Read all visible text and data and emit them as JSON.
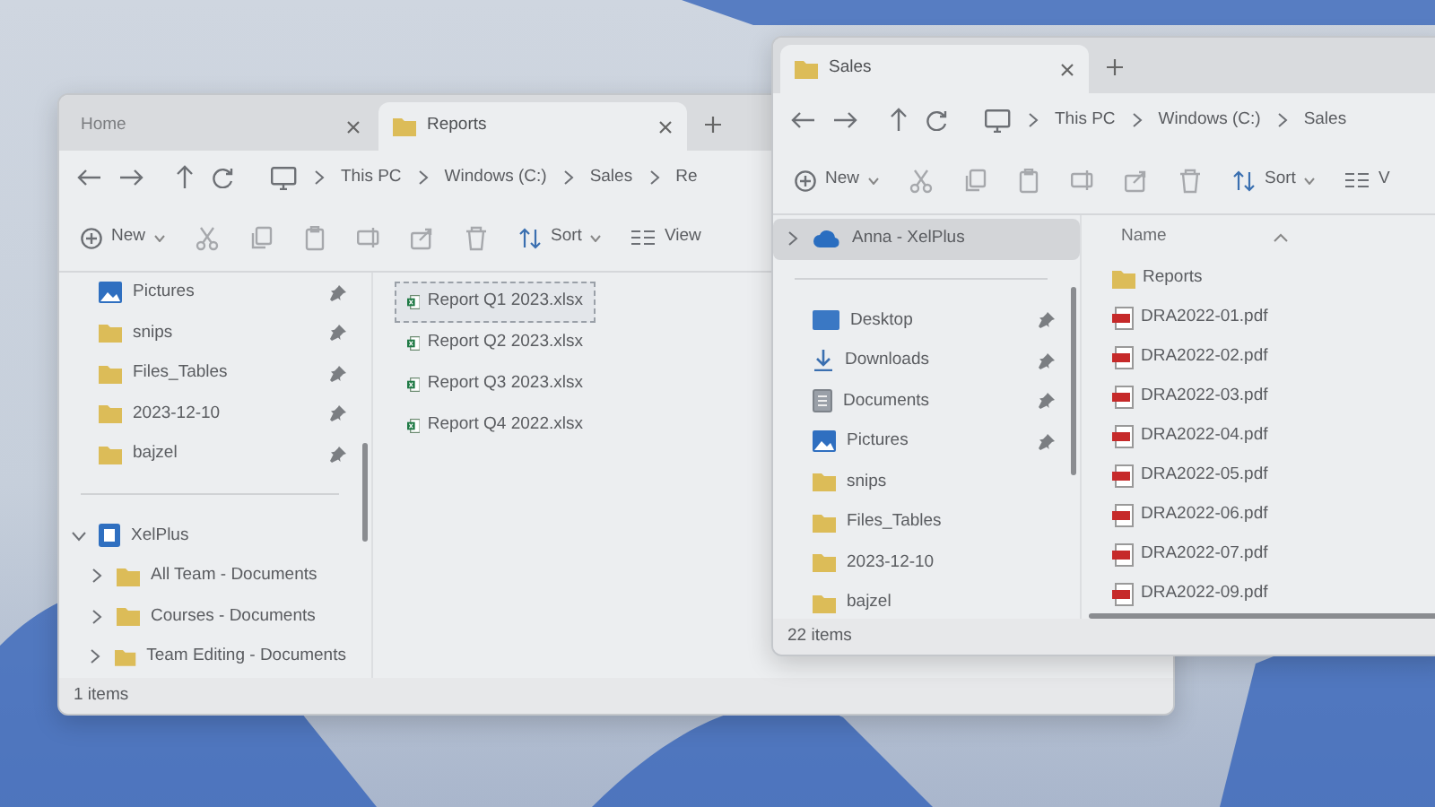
{
  "windows": [
    {
      "tabs": [
        {
          "label": "Home",
          "selected": false,
          "kind": "plain"
        },
        {
          "label": "Reports",
          "selected": true,
          "kind": "folder"
        }
      ],
      "breadcrumb": [
        "This PC",
        "Windows (C:)",
        "Sales",
        "Re"
      ],
      "toolbar": {
        "new_label": "New",
        "sort_label": "Sort",
        "view_label": "View"
      },
      "sidebar": [
        {
          "items": [
            {
              "label": "Pictures",
              "kind": "pictures",
              "pinned": true,
              "selected": false
            },
            {
              "label": "snips",
              "kind": "folder",
              "pinned": true,
              "selected": false
            },
            {
              "label": "Files_Tables",
              "kind": "folder",
              "pinned": true,
              "selected": false
            },
            {
              "label": "2023-12-10",
              "kind": "folder",
              "pinned": true,
              "selected": false
            },
            {
              "label": "bajzel",
              "kind": "folder",
              "pinned": true,
              "selected": false
            }
          ]
        },
        {
          "items": [
            {
              "label": "XelPlus",
              "kind": "site",
              "pinned": false,
              "selected": false,
              "expanded": true,
              "children": [
                {
                  "label": "All Team - Documents",
                  "kind": "folder",
                  "pinned": false,
                  "selected": false,
                  "expanded": false
                },
                {
                  "label": "Courses - Documents",
                  "kind": "folder",
                  "pinned": false,
                  "selected": false,
                  "expanded": false
                },
                {
                  "label": "Team Editing - Documents",
                  "kind": "folder",
                  "pinned": false,
                  "selected": false,
                  "expanded": false
                }
              ]
            }
          ]
        }
      ],
      "files": [
        {
          "name": "Report Q1 2023.xlsx",
          "kind": "xlsx",
          "selected": true
        },
        {
          "name": "Report Q2 2023.xlsx",
          "kind": "xlsx",
          "selected": false
        },
        {
          "name": "Report Q3 2023.xlsx",
          "kind": "xlsx",
          "selected": false
        },
        {
          "name": "Report Q4 2022.xlsx",
          "kind": "xlsx",
          "selected": false
        }
      ],
      "status": "1 items"
    },
    {
      "tabs": [
        {
          "label": "Sales",
          "selected": true,
          "kind": "folder"
        }
      ],
      "breadcrumb": [
        "This PC",
        "Windows (C:)",
        "Sales"
      ],
      "toolbar": {
        "new_label": "New",
        "sort_label": "Sort",
        "view_label": "V"
      },
      "sidebar": [
        {
          "items": [
            {
              "label": "Anna - XelPlus",
              "kind": "cloud",
              "pinned": false,
              "selected": true,
              "expanded": false
            }
          ]
        },
        {
          "items": [
            {
              "label": "Desktop",
              "kind": "desktop",
              "pinned": true,
              "selected": false
            },
            {
              "label": "Downloads",
              "kind": "downloads",
              "pinned": true,
              "selected": false
            },
            {
              "label": "Documents",
              "kind": "documents",
              "pinned": true,
              "selected": false
            },
            {
              "label": "Pictures",
              "kind": "pictures",
              "pinned": true,
              "selected": false
            },
            {
              "label": "snips",
              "kind": "folder",
              "pinned": false,
              "selected": false
            },
            {
              "label": "Files_Tables",
              "kind": "folder",
              "pinned": false,
              "selected": false
            },
            {
              "label": "2023-12-10",
              "kind": "folder",
              "pinned": false,
              "selected": false
            },
            {
              "label": "bajzel",
              "kind": "folder",
              "pinned": false,
              "selected": false
            }
          ]
        }
      ],
      "column_header": "Name",
      "files": [
        {
          "name": "Reports",
          "kind": "folder",
          "selected": false
        },
        {
          "name": "DRA2022-01.pdf",
          "kind": "pdf",
          "selected": false
        },
        {
          "name": "DRA2022-02.pdf",
          "kind": "pdf",
          "selected": false
        },
        {
          "name": "DRA2022-03.pdf",
          "kind": "pdf",
          "selected": false
        },
        {
          "name": "DRA2022-04.pdf",
          "kind": "pdf",
          "selected": false
        },
        {
          "name": "DRA2022-05.pdf",
          "kind": "pdf",
          "selected": false
        },
        {
          "name": "DRA2022-06.pdf",
          "kind": "pdf",
          "selected": false
        },
        {
          "name": "DRA2022-07.pdf",
          "kind": "pdf",
          "selected": false
        },
        {
          "name": "DRA2022-09.pdf",
          "kind": "pdf",
          "selected": false
        }
      ],
      "status": "22 items"
    }
  ]
}
